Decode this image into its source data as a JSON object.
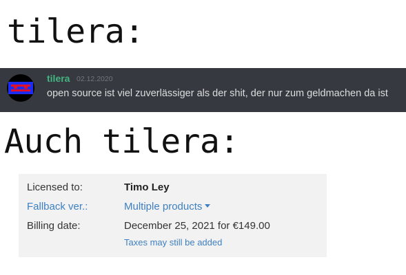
{
  "captions": {
    "first": "tilera:",
    "second": "Auch tilera:"
  },
  "discord_message": {
    "username": "tilera",
    "date": "02.12.2020",
    "text": "open source ist viel zuverlässiger als der shit, der nur zum geldmachen da ist",
    "avatar_icon": "avatar-icon",
    "colors": {
      "background": "#36393f",
      "username": "#43b581",
      "text": "#dcddde"
    }
  },
  "license": {
    "licensed_to_label": "Licensed to:",
    "licensed_to_value": "Timo Ley",
    "fallback_label": "Fallback ver.:",
    "fallback_value": "Multiple products",
    "billing_label": "Billing date:",
    "billing_value": "December 25, 2021 for €149.00",
    "tax_note": "Taxes may still be added",
    "colors": {
      "background": "#f2f2f2",
      "link": "#3e7fc1"
    }
  }
}
